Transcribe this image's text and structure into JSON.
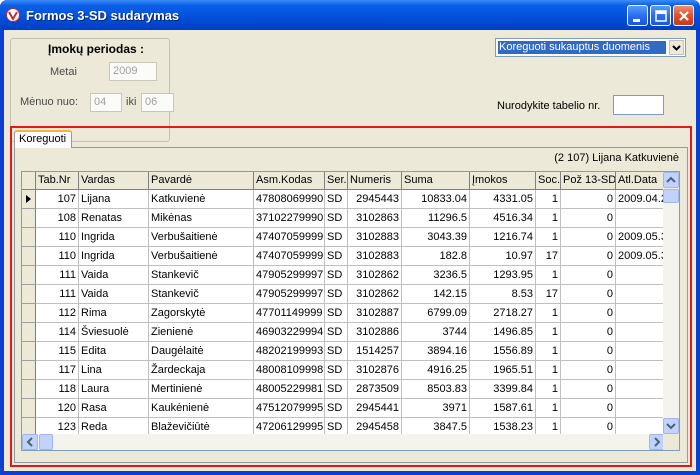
{
  "window": {
    "title": "Formos 3-SD sudarymas"
  },
  "period": {
    "title": "Įmokų periodas :",
    "year_label": "Metai",
    "year_value": "2009",
    "month_from_label": "Mėnuo nuo:",
    "month_from_value": "04",
    "month_to_label": "iki",
    "month_to_value": "06"
  },
  "mode_select": {
    "selected": "Koreguoti sukauptus duomenis"
  },
  "tabel": {
    "label": "Nurodykite tabelio nr.",
    "value": ""
  },
  "tab": {
    "label": "Koreguoti"
  },
  "info": {
    "text": "(2  107)   Lijana Katkuvienė"
  },
  "grid": {
    "columns": [
      "Tab.Nr",
      "Vardas",
      "Pavardė",
      "Asm.Kodas",
      "Ser.",
      "Numeris",
      "Suma",
      "Įmokos",
      "Soc.",
      "Pož 13-SD",
      "Atl.Data"
    ],
    "rows": [
      [
        "107",
        "Lijana",
        "Katkuvienė",
        "47808069990",
        "SD",
        "2945443",
        "10833.04",
        "4331.05",
        "1",
        "0",
        "2009.04.2"
      ],
      [
        "108",
        "Renatas",
        "Mikėnas",
        "37102279990",
        "SD",
        "3102863",
        "11296.5",
        "4516.34",
        "1",
        "0",
        ""
      ],
      [
        "110",
        "Ingrida",
        "Verbušaitienė",
        "47407059999",
        "SD",
        "3102883",
        "3043.39",
        "1216.74",
        "1",
        "0",
        "2009.05.3"
      ],
      [
        "110",
        "Ingrida",
        "Verbušaitienė",
        "47407059999",
        "SD",
        "3102883",
        "182.8",
        "10.97",
        "17",
        "0",
        "2009.05.3"
      ],
      [
        "111",
        "Vaida",
        "Stankevič",
        "47905299997",
        "SD",
        "3102862",
        "3236.5",
        "1293.95",
        "1",
        "0",
        ""
      ],
      [
        "111",
        "Vaida",
        "Stankevič",
        "47905299997",
        "SD",
        "3102862",
        "142.15",
        "8.53",
        "17",
        "0",
        ""
      ],
      [
        "112",
        "Rima",
        "Zagorskytė",
        "47701149999",
        "SD",
        "3102887",
        "6799.09",
        "2718.27",
        "1",
        "0",
        ""
      ],
      [
        "114",
        "Šviesuolė",
        "Zienienė",
        "46903229994",
        "SD",
        "3102886",
        "3744",
        "1496.85",
        "1",
        "0",
        ""
      ],
      [
        "115",
        "Edita",
        "Daugėlaitė",
        "48202199993",
        "SD",
        "1514257",
        "3894.16",
        "1556.89",
        "1",
        "0",
        ""
      ],
      [
        "117",
        "Lina",
        "Žardeckaja",
        "48008109998",
        "SD",
        "3102876",
        "4916.25",
        "1965.51",
        "1",
        "0",
        ""
      ],
      [
        "118",
        "Laura",
        "Mertinienė",
        "48005229981",
        "SD",
        "2873509",
        "8503.83",
        "3399.84",
        "1",
        "0",
        ""
      ],
      [
        "120",
        "Rasa",
        "Kaukėnienė",
        "47512079995",
        "SD",
        "2945441",
        "3971",
        "1587.61",
        "1",
        "0",
        ""
      ],
      [
        "123",
        "Reda",
        "Blaževičiūtė",
        "47206129995",
        "SD",
        "2945458",
        "3847.5",
        "1538.23",
        "1",
        "0",
        ""
      ]
    ]
  }
}
